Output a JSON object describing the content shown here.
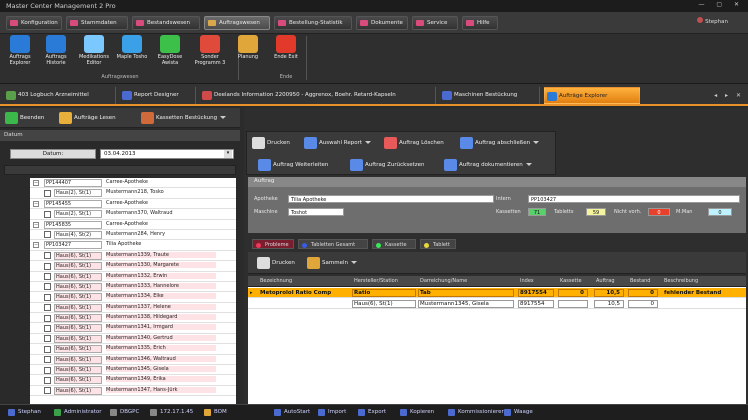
{
  "window": {
    "title": "Master Center Management 2 Pro"
  },
  "menu": [
    {
      "label": "Konfiguration",
      "color": "#d84b7c"
    },
    {
      "label": "Stammdaten",
      "color": "#d84b7c"
    },
    {
      "label": "Bestandswesen",
      "color": "#d84b7c"
    },
    {
      "label": "Auftragswesen",
      "color": "#d8a84b",
      "active": true
    },
    {
      "label": "Bestellung-Statistik",
      "color": "#d84b7c"
    },
    {
      "label": "Dokumente",
      "color": "#d84b7c"
    },
    {
      "label": "Service",
      "color": "#d84b7c"
    },
    {
      "label": "Hilfe",
      "color": "#d84b7c"
    }
  ],
  "user": "Stephan",
  "ribbon": {
    "buttons": [
      {
        "label": "Auftrags Explorer",
        "icon": "explorer-icon",
        "color": "#2a7bd8"
      },
      {
        "label": "Auftrags Historie",
        "icon": "history-icon",
        "color": "#2a7bd8"
      },
      {
        "label": "Medikations Editor",
        "icon": "medication-icon",
        "color": "#7bc8ff"
      },
      {
        "label": "Maple Tosho",
        "icon": "network-icon",
        "color": "#3aa0e8"
      },
      {
        "label": "EasyDose Awista",
        "icon": "network-green-icon",
        "color": "#3cc04a"
      },
      {
        "label": "Sonder Programm 3",
        "icon": "network-red-icon",
        "color": "#e04a3a"
      },
      {
        "label": "Planung",
        "icon": "planning-icon",
        "color": "#e0a63a"
      },
      {
        "label": "Ende Exit",
        "icon": "exit-icon",
        "color": "#e23a2a"
      }
    ],
    "group_auftrag": "Auftragswesen",
    "group_ende": "Ende"
  },
  "doctabs": [
    {
      "label": "403 Logbuch Arzneimittel",
      "color": "#5aa04a"
    },
    {
      "label": "Report Designer",
      "color": "#4a6ad0"
    },
    {
      "label": "Deelands Information 2200950 - Aggrenox, Boehr. Retard-Kapseln",
      "color": "#d04a4a"
    },
    {
      "label": "Maschinen Bestückung",
      "color": "#4a6ad0"
    },
    {
      "label": "Aufträge Explorer",
      "color": "#2a7bd8",
      "active": true
    }
  ],
  "left_toolbar": {
    "beenden": "Beenden",
    "auftraege_lesen": "Aufträge Lesen",
    "kassetten": "Kassetten Bestückung"
  },
  "left": {
    "section": "Datum",
    "date_button": "Datum:",
    "date_value": "03.04.2013"
  },
  "tree": [
    {
      "c1": "PP144407",
      "c2": "Carree-Apotheke",
      "type": "root"
    },
    {
      "c1": "Haus(2), St(1)",
      "c2": "Mustermann218, Tosko",
      "type": "sub"
    },
    {
      "c1": "PP145455",
      "c2": "Carree-Apotheke",
      "type": "root"
    },
    {
      "c1": "Haus(2), St(1)",
      "c2": "Mustermann370, Waltraud",
      "type": "sub"
    },
    {
      "c1": "PP145835",
      "c2": "Carree-Apotheke",
      "type": "root"
    },
    {
      "c1": "Haus(4), St(2)",
      "c2": "Mustermann284, Henry",
      "type": "sub"
    },
    {
      "c1": "PP103427",
      "c2": "Tilia Apotheke",
      "type": "root"
    },
    {
      "c1": "Haus(6), St(1)",
      "c2": "Mustermann1339, Traute",
      "type": "pink"
    },
    {
      "c1": "Haus(6), St(1)",
      "c2": "Mustermann1330, Margarete",
      "type": "pink"
    },
    {
      "c1": "Haus(6), St(1)",
      "c2": "Mustermann1332, Erwin",
      "type": "pink"
    },
    {
      "c1": "Haus(6), St(1)",
      "c2": "Mustermann1333, Hannelore",
      "type": "pink"
    },
    {
      "c1": "Haus(6), St(1)",
      "c2": "Mustermann1334, Elke",
      "type": "pink"
    },
    {
      "c1": "Haus(6), St(1)",
      "c2": "Mustermann1337, Helene",
      "type": "pink"
    },
    {
      "c1": "Haus(6), St(1)",
      "c2": "Mustermann1338, Hildegard",
      "type": "pink"
    },
    {
      "c1": "Haus(6), St(1)",
      "c2": "Mustermann1341, Irmgard",
      "type": "pink"
    },
    {
      "c1": "Haus(6), St(1)",
      "c2": "Mustermann1340, Gertrud",
      "type": "pink"
    },
    {
      "c1": "Haus(6), St(1)",
      "c2": "Mustermann1335, Erich",
      "type": "pink"
    },
    {
      "c1": "Haus(6), St(1)",
      "c2": "Mustermann1346, Waltraud",
      "type": "pink"
    },
    {
      "c1": "Haus(6), St(1)",
      "c2": "Mustermann1345, Gisela",
      "type": "pink"
    },
    {
      "c1": "Haus(6), St(1)",
      "c2": "Mustermann1349, Erika",
      "type": "pink"
    },
    {
      "c1": "Haus(6), St(1)",
      "c2": "Mustermann1347, Hans-Jürk",
      "type": "pink"
    }
  ],
  "right_toolbar": {
    "drucken": "Drucken",
    "auswahl_report": "Auswahl Report",
    "auftrag_loeschen": "Auftrag Löschen",
    "auftrag_abschliessen": "Auftrag abschließen",
    "auftrag_weiterleiten": "Auftrag Weiterleiten",
    "auftrag_zuruecksetzen": "Auftrag Zurücksetzen",
    "auftrag_dokumentieren": "Auftrag dokumentieren"
  },
  "auftrag": {
    "header": "Auftrag",
    "apotheke_label": "Apotheke",
    "apotheke_value": "Tilia Apotheke",
    "intern_label": "Intern",
    "intern_value": "PP103427",
    "maschine_label": "Maschine",
    "maschine_value": "Toshot",
    "kassetten_label": "Kassetten",
    "kassetten_value": "71",
    "tabletts_label": "Tabletts",
    "tabletts_value": "59",
    "nicht_vorh_label": "Nicht vorh.",
    "nicht_vorh_value": "0",
    "man_label": "M.Man",
    "man_value": "0"
  },
  "tabs2": [
    {
      "label": "Probleme",
      "color": "#e83a5a",
      "active": true
    },
    {
      "label": "Tabletten Gesamt",
      "color": "#3a5ae8"
    },
    {
      "label": "Kassette",
      "color": "#3ae85a"
    },
    {
      "label": "Tablett",
      "color": "#e8d83a"
    }
  ],
  "tool2": {
    "drucken": "Drucken",
    "sammeln": "Sammeln"
  },
  "grid": {
    "headers": [
      "Bezeichnung",
      "Hersteller/Station",
      "Darreichung/Name",
      "Index",
      "Kassette",
      "Auftrag",
      "Bestand",
      "Beschreibung"
    ],
    "rows": [
      {
        "c": [
          "Metoprolol Ratio Comp",
          "Ratio",
          "Tab",
          "8917554",
          "0",
          "10,5",
          "0",
          "fehlender Bestand"
        ],
        "sel": true
      },
      {
        "c": [
          "",
          "Haus(6), St(1)",
          "Mustermann1345, Gisela",
          "8917554",
          "",
          "10,5",
          "0",
          ""
        ],
        "sel": false
      }
    ]
  },
  "status": [
    {
      "label": "Stephan",
      "color": "#4a6ad0"
    },
    {
      "label": "Administrator",
      "color": "#3aa04a"
    },
    {
      "label": "DBGPC",
      "color": "#888"
    },
    {
      "label": "172.17.1.45",
      "color": "#888"
    },
    {
      "label": "BOM",
      "color": "#e0a63a"
    },
    {
      "label": "AutoStart",
      "color": "#4a6ad0"
    },
    {
      "label": "Import",
      "color": "#4a6ad0"
    },
    {
      "label": "Export",
      "color": "#4a6ad0"
    },
    {
      "label": "Kopieren",
      "color": "#4a6ad0"
    },
    {
      "label": "Kommissionierer",
      "color": "#4a6ad0"
    },
    {
      "label": "Waage",
      "color": "#4a6ad0"
    }
  ]
}
